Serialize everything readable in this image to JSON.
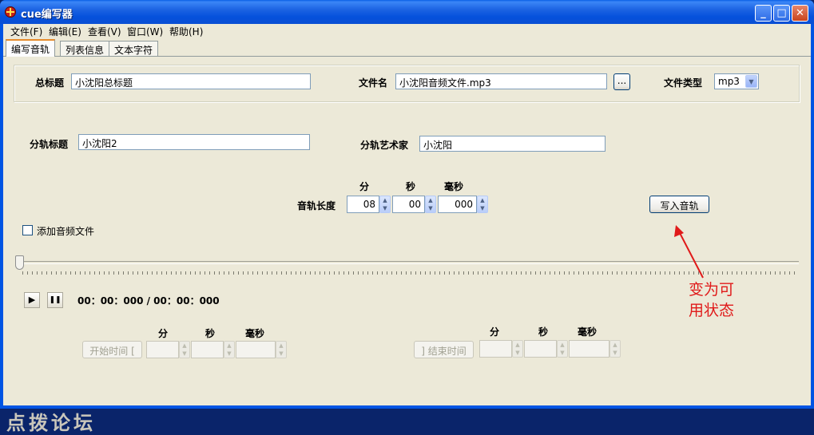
{
  "window": {
    "title": "cue编写器"
  },
  "titlebar_buttons": {
    "minimize": "_",
    "maximize": "□",
    "close": "✕"
  },
  "menu": [
    "文件(F)",
    "编辑(E)",
    "查看(V)",
    "窗口(W)",
    "帮助(H)"
  ],
  "tabs": [
    "编写音轨",
    "列表信息",
    "文本字符"
  ],
  "album": {
    "title_label": "总标题",
    "title_value": "小沈阳总标题",
    "file_label": "文件名",
    "file_value": "小沈阳音频文件.mp3",
    "browse_label": "...",
    "type_label": "文件类型",
    "type_value": "mp3"
  },
  "track": {
    "title_label": "分轨标题",
    "title_value": "小沈阳2",
    "artist_label": "分轨艺术家",
    "artist_value": "小沈阳",
    "length_label": "音轨长度",
    "min_header": "分",
    "sec_header": "秒",
    "ms_header": "毫秒",
    "min_value": "08",
    "sec_value": "00",
    "ms_value": "000",
    "write_button": "写入音轨"
  },
  "add_audio_label": "添加音频文件",
  "add_audio_checked": false,
  "player": {
    "time_display": "00：00：000 / 00：00：000",
    "position": 0
  },
  "start_time": {
    "button_label": "开始时间 [",
    "min_header": "分",
    "sec_header": "秒",
    "ms_header": "毫秒"
  },
  "end_time": {
    "button_label": "] 结束时间",
    "min_header": "分",
    "sec_header": "秒",
    "ms_header": "毫秒"
  },
  "annotation": {
    "line1": "变为可",
    "line2": "用状态",
    "color": "#e01a1a"
  },
  "watermark": "点拨论坛",
  "icons": {
    "play": "▶",
    "pause": "❚❚",
    "up": "▲",
    "down": "▼",
    "dropdown": "▼"
  }
}
